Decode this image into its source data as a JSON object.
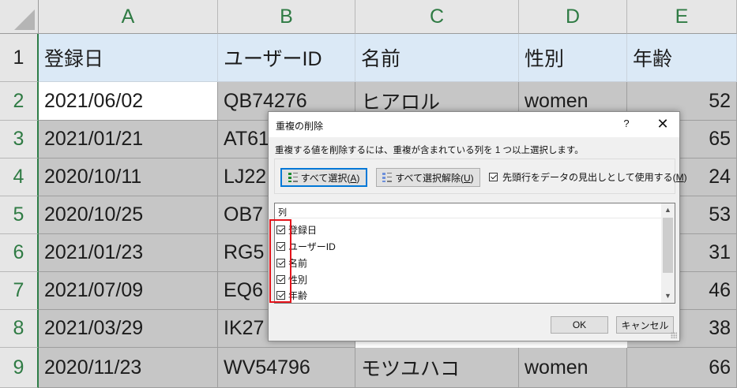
{
  "sheet": {
    "columns": [
      "A",
      "B",
      "C",
      "D",
      "E"
    ],
    "row_numbers": [
      "1",
      "2",
      "3",
      "4",
      "5",
      "6",
      "7",
      "8",
      "9"
    ],
    "headers": [
      "登録日",
      "ユーザーID",
      "名前",
      "性別",
      "年齢"
    ],
    "rows": [
      [
        "2021/06/02",
        "QB74276",
        "ヒアロル",
        "women",
        "52"
      ],
      [
        "2021/01/21",
        "AT61",
        "",
        "",
        "65"
      ],
      [
        "2020/10/11",
        "LJ22",
        "",
        "",
        "24"
      ],
      [
        "2020/10/25",
        "OB7",
        "",
        "",
        "53"
      ],
      [
        "2021/01/23",
        "RG5",
        "",
        "",
        "31"
      ],
      [
        "2021/07/09",
        "EQ6",
        "",
        "",
        "46"
      ],
      [
        "2021/03/29",
        "IK27",
        "",
        "",
        "38"
      ],
      [
        "2020/11/23",
        "WV54796",
        "モツユハコ",
        "women",
        "66"
      ]
    ]
  },
  "dialog": {
    "title": "重複の削除",
    "help": "?",
    "close": "✕",
    "instruction": "重複する値を削除するには、重複が含まれている列を 1 つ以上選択します。",
    "select_all": "すべて選択(",
    "select_all_key": "A",
    "deselect_all": "すべて選択解除(",
    "deselect_all_key": "U",
    "close_paren": ")",
    "header_checkbox_label": "先頭行をデータの見出しとして使用する(",
    "header_checkbox_key": "M",
    "columns_label": "列",
    "column_items": [
      "登録日",
      "ユーザーID",
      "名前",
      "性別",
      "年齢"
    ],
    "ok": "OK",
    "cancel": "キャンセル",
    "scroll_up": "▲",
    "scroll_down": "▼"
  },
  "colors": {
    "header_fill": "#dbe9f6",
    "highlight_box": "#e4131b",
    "row_header_text": "#2f7b44",
    "default_button_border": "#0078d7"
  }
}
